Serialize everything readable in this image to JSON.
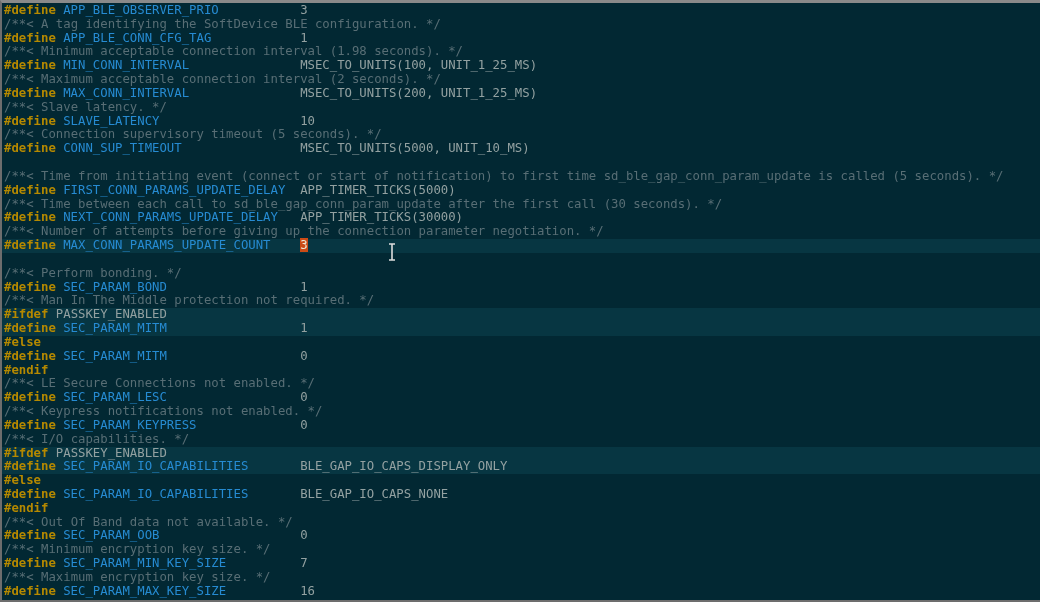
{
  "editor": {
    "lines": [
      {
        "kind": "define",
        "keyword": "#define",
        "name": "APP_BLE_OBSERVER_PRIO",
        "value": "3",
        "highlighted": false,
        "cursor": false
      },
      {
        "kind": "comment",
        "text": "/**< A tag identifying the SoftDevice BLE configuration. */",
        "highlighted": false,
        "cursor": false
      },
      {
        "kind": "define",
        "keyword": "#define",
        "name": "APP_BLE_CONN_CFG_TAG",
        "value": "1",
        "highlighted": false,
        "cursor": false
      },
      {
        "kind": "comment",
        "text": "/**< Minimum acceptable connection interval (1.98 seconds). */",
        "highlighted": false,
        "cursor": false
      },
      {
        "kind": "define",
        "keyword": "#define",
        "name": "MIN_CONN_INTERVAL",
        "value": "MSEC_TO_UNITS(100, UNIT_1_25_MS)",
        "highlighted": false,
        "cursor": false
      },
      {
        "kind": "comment",
        "text": "/**< Maximum acceptable connection interval (2 seconds). */",
        "highlighted": false,
        "cursor": false
      },
      {
        "kind": "define",
        "keyword": "#define",
        "name": "MAX_CONN_INTERVAL",
        "value": "MSEC_TO_UNITS(200, UNIT_1_25_MS)",
        "highlighted": false,
        "cursor": false
      },
      {
        "kind": "comment",
        "text": "/**< Slave latency. */",
        "highlighted": false,
        "cursor": false
      },
      {
        "kind": "define",
        "keyword": "#define",
        "name": "SLAVE_LATENCY",
        "value": "10",
        "highlighted": false,
        "cursor": false
      },
      {
        "kind": "comment",
        "text": "/**< Connection supervisory timeout (5 seconds). */",
        "highlighted": false,
        "cursor": false
      },
      {
        "kind": "define",
        "keyword": "#define",
        "name": "CONN_SUP_TIMEOUT",
        "value": "MSEC_TO_UNITS(5000, UNIT_10_MS)",
        "highlighted": false,
        "cursor": false
      },
      {
        "kind": "blank",
        "highlighted": false,
        "cursor": false
      },
      {
        "kind": "comment",
        "text": "/**< Time from initiating event (connect or start of notification) to first time sd_ble_gap_conn_param_update is called (5 seconds). */",
        "highlighted": false,
        "cursor": false
      },
      {
        "kind": "define",
        "keyword": "#define",
        "name": "FIRST_CONN_PARAMS_UPDATE_DELAY",
        "value": "APP_TIMER_TICKS(5000)",
        "highlighted": false,
        "cursor": false
      },
      {
        "kind": "comment",
        "text": "/**< Time between each call to sd_ble_gap_conn_param_update after the first call (30 seconds). */",
        "highlighted": false,
        "cursor": false
      },
      {
        "kind": "define",
        "keyword": "#define",
        "name": "NEXT_CONN_PARAMS_UPDATE_DELAY",
        "value": "APP_TIMER_TICKS(30000)",
        "highlighted": false,
        "cursor": false
      },
      {
        "kind": "comment",
        "text": "/**< Number of attempts before giving up the connection parameter negotiation. */",
        "highlighted": false,
        "cursor": false
      },
      {
        "kind": "define",
        "keyword": "#define",
        "name": "MAX_CONN_PARAMS_UPDATE_COUNT",
        "value": "3",
        "highlighted": true,
        "cursor": true
      },
      {
        "kind": "blank",
        "highlighted": false,
        "cursor": false
      },
      {
        "kind": "comment",
        "text": "/**< Perform bonding. */",
        "highlighted": false,
        "cursor": false
      },
      {
        "kind": "define",
        "keyword": "#define",
        "name": "SEC_PARAM_BOND",
        "value": "1",
        "highlighted": false,
        "cursor": false
      },
      {
        "kind": "comment",
        "text": "/**< Man In The Middle protection not required. */",
        "highlighted": false,
        "cursor": false
      },
      {
        "kind": "directive",
        "keyword": "#ifdef",
        "arg": "PASSKEY_ENABLED",
        "highlighted": true,
        "cursor": false
      },
      {
        "kind": "define",
        "keyword": "#define",
        "name": "SEC_PARAM_MITM",
        "value": "1",
        "highlighted": true,
        "cursor": false
      },
      {
        "kind": "directive",
        "keyword": "#else",
        "highlighted": false,
        "cursor": false
      },
      {
        "kind": "define",
        "keyword": "#define",
        "name": "SEC_PARAM_MITM",
        "value": "0",
        "highlighted": false,
        "cursor": false
      },
      {
        "kind": "directive",
        "keyword": "#endif",
        "highlighted": false,
        "cursor": false
      },
      {
        "kind": "comment",
        "text": "/**< LE Secure Connections not enabled. */",
        "highlighted": false,
        "cursor": false
      },
      {
        "kind": "define",
        "keyword": "#define",
        "name": "SEC_PARAM_LESC",
        "value": "0",
        "highlighted": false,
        "cursor": false
      },
      {
        "kind": "comment",
        "text": "/**< Keypress notifications not enabled. */",
        "highlighted": false,
        "cursor": false
      },
      {
        "kind": "define",
        "keyword": "#define",
        "name": "SEC_PARAM_KEYPRESS",
        "value": "0",
        "highlighted": false,
        "cursor": false
      },
      {
        "kind": "comment",
        "text": "/**< I/O capabilities. */",
        "highlighted": false,
        "cursor": false
      },
      {
        "kind": "directive",
        "keyword": "#ifdef",
        "arg": "PASSKEY_ENABLED",
        "highlighted": true,
        "cursor": false
      },
      {
        "kind": "define",
        "keyword": "#define",
        "name": "SEC_PARAM_IO_CAPABILITIES",
        "value": "BLE_GAP_IO_CAPS_DISPLAY_ONLY",
        "highlighted": true,
        "cursor": false
      },
      {
        "kind": "directive",
        "keyword": "#else",
        "highlighted": false,
        "cursor": false
      },
      {
        "kind": "define",
        "keyword": "#define",
        "name": "SEC_PARAM_IO_CAPABILITIES",
        "value": "BLE_GAP_IO_CAPS_NONE",
        "highlighted": false,
        "cursor": false
      },
      {
        "kind": "directive",
        "keyword": "#endif",
        "highlighted": false,
        "cursor": false
      },
      {
        "kind": "comment",
        "text": "/**< Out Of Band data not available. */",
        "highlighted": false,
        "cursor": false
      },
      {
        "kind": "define",
        "keyword": "#define",
        "name": "SEC_PARAM_OOB",
        "value": "0",
        "highlighted": false,
        "cursor": false
      },
      {
        "kind": "comment",
        "text": "/**< Minimum encryption key size. */",
        "highlighted": false,
        "cursor": false
      },
      {
        "kind": "define",
        "keyword": "#define",
        "name": "SEC_PARAM_MIN_KEY_SIZE",
        "value": "7",
        "highlighted": false,
        "cursor": false
      },
      {
        "kind": "comment",
        "text": "/**< Maximum encryption key size. */",
        "highlighted": false,
        "cursor": false
      },
      {
        "kind": "define",
        "keyword": "#define",
        "name": "SEC_PARAM_MAX_KEY_SIZE",
        "value": "16",
        "highlighted": false,
        "cursor": false
      }
    ]
  }
}
